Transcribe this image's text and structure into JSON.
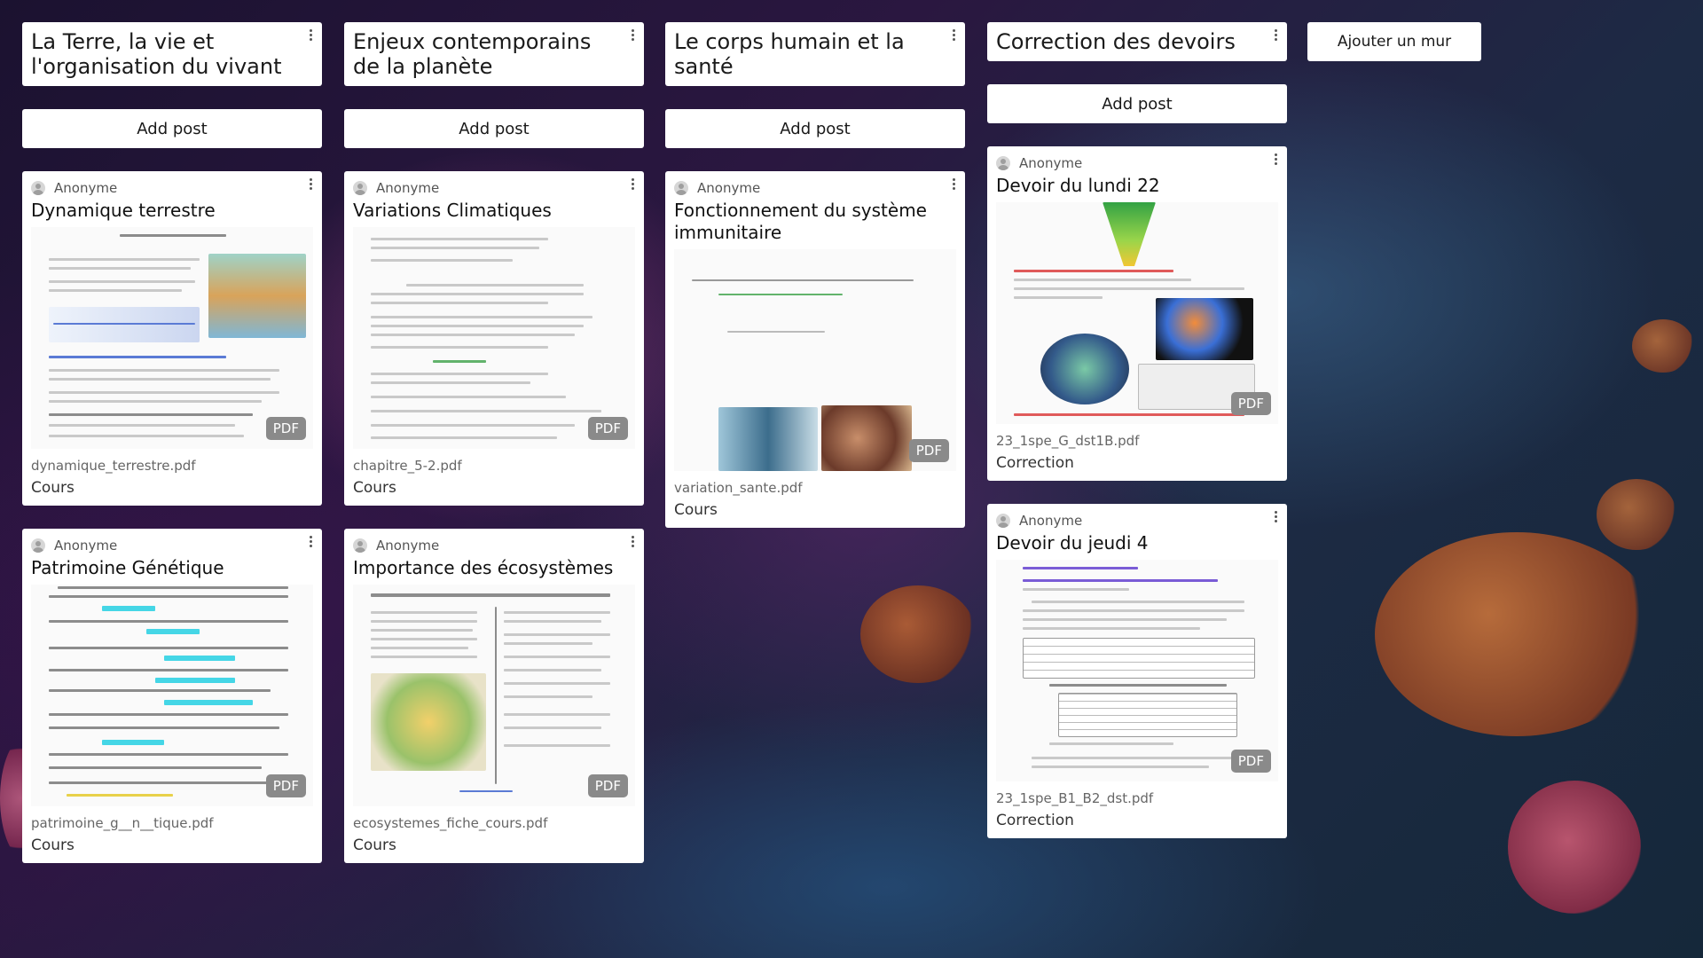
{
  "columns": [
    {
      "title": "La Terre, la vie et l'organisation du vivant",
      "add_post_label": "Add post",
      "posts": [
        {
          "author": "Anonyme",
          "title": "Dynamique terrestre",
          "badge": "PDF",
          "filename": "dynamique_terrestre.pdf",
          "category": "Cours"
        },
        {
          "author": "Anonyme",
          "title": "Patrimoine Génétique",
          "badge": "PDF",
          "filename": "patrimoine_g__n__tique.pdf",
          "category": "Cours"
        }
      ]
    },
    {
      "title": "Enjeux contemporains de la planète",
      "add_post_label": "Add post",
      "posts": [
        {
          "author": "Anonyme",
          "title": "Variations Climatiques",
          "badge": "PDF",
          "filename": "chapitre_5-2.pdf",
          "category": "Cours"
        },
        {
          "author": "Anonyme",
          "title": "Importance des écosystèmes",
          "badge": "PDF",
          "filename": "ecosystemes_fiche_cours.pdf",
          "category": "Cours"
        }
      ]
    },
    {
      "title": "Le corps humain et la santé",
      "add_post_label": "Add post",
      "posts": [
        {
          "author": "Anonyme",
          "title": "Fonctionnement du système immunitaire",
          "badge": "PDF",
          "filename": "variation_sante.pdf",
          "category": "Cours"
        }
      ]
    },
    {
      "title": "Correction des devoirs",
      "add_post_label": "Add post",
      "posts": [
        {
          "author": "Anonyme",
          "title": "Devoir du lundi 22",
          "badge": "PDF",
          "filename": "23_1spe_G_dst1B.pdf",
          "category": "Correction"
        },
        {
          "author": "Anonyme",
          "title": "Devoir du jeudi 4",
          "badge": "PDF",
          "filename": "23_1spe_B1_B2_dst.pdf",
          "category": "Correction"
        }
      ]
    }
  ],
  "add_wall_label": "Ajouter un mur",
  "colors": {
    "card": "#ffffff",
    "badge": "#8a8a8a",
    "background": "#1d2a44"
  },
  "icons": {
    "menu": "kebab-menu-icon",
    "avatar": "user-avatar-icon"
  }
}
